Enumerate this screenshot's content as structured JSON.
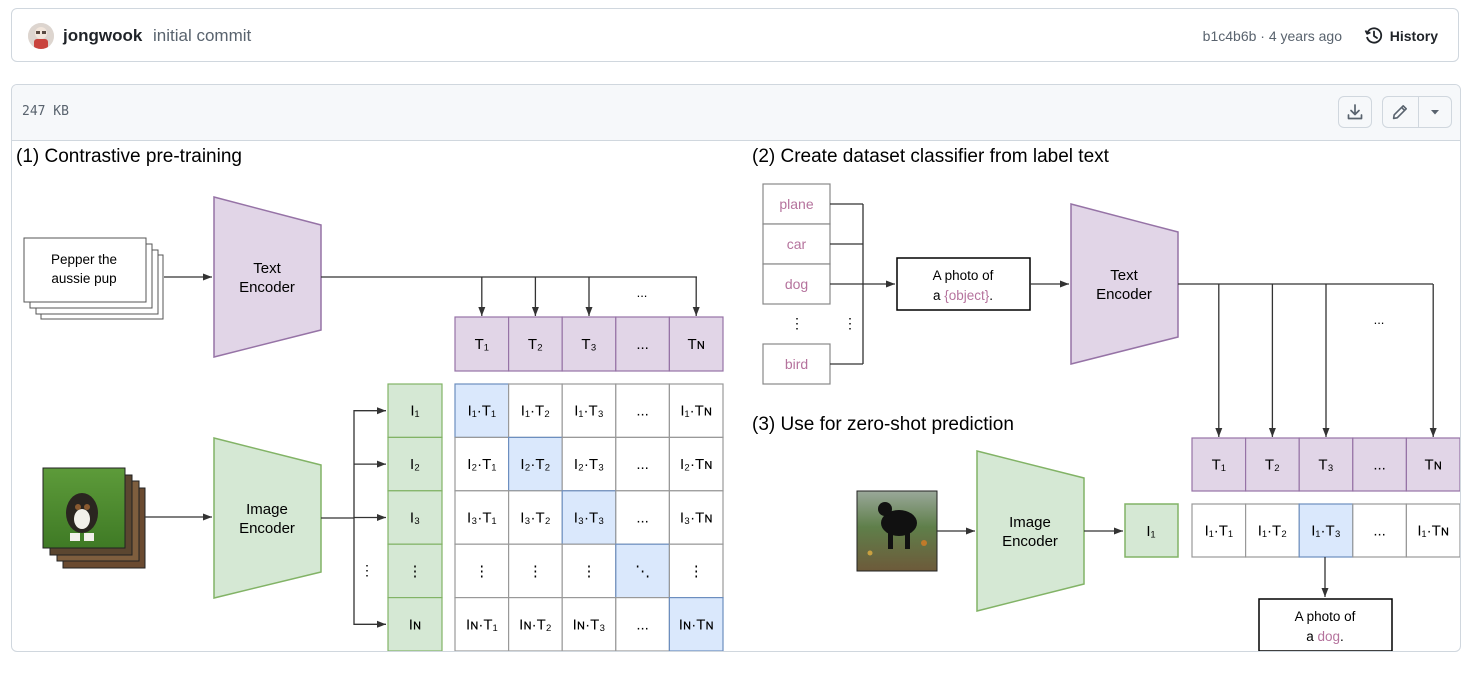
{
  "commit": {
    "author": "jongwook",
    "message": "initial commit",
    "sha_age": "b1c4b6b · 4 years ago",
    "history_label": "History",
    "avatar_icon": "user-avatar",
    "history_icon": "clock-history-icon"
  },
  "file": {
    "size": "247 KB",
    "download_icon": "download-icon",
    "edit_icon": "pencil-icon",
    "dropdown_icon": "triangle-down-icon"
  },
  "figure": {
    "panel1_title": "(1) Contrastive pre-training",
    "panel2_title": "(2) Create dataset classifier from label text",
    "panel3_title": "(3) Use for zero-shot prediction",
    "text_input": [
      "Pepper the",
      "aussie pup"
    ],
    "text_encoder": [
      "Text",
      "Encoder"
    ],
    "image_encoder": [
      "Image",
      "Encoder"
    ],
    "labels": [
      "plane",
      "car",
      "dog",
      "bird"
    ],
    "vdots": "⋮",
    "ellipsis": "...",
    "ddots": "⋱",
    "template": {
      "prefix": "A photo of",
      "line2_prefix": "a ",
      "placeholder": "{object}",
      "suffix": "."
    },
    "prediction": {
      "prefix": "A photo of",
      "line2_prefix": "a ",
      "word": "dog",
      "suffix": "."
    },
    "t_labels": [
      "T₁",
      "T₂",
      "T₃",
      "...",
      "Tɴ"
    ],
    "i_labels": [
      "I₁",
      "I₂",
      "I₃",
      "⋮",
      "Iɴ"
    ],
    "i_single": "I₁",
    "matrix": [
      [
        "I₁·T₁",
        "I₁·T₂",
        "I₁·T₃",
        "...",
        "I₁·Tɴ"
      ],
      [
        "I₂·T₁",
        "I₂·T₂",
        "I₂·T₃",
        "...",
        "I₂·Tɴ"
      ],
      [
        "I₃·T₁",
        "I₃·T₂",
        "I₃·T₃",
        "...",
        "I₃·Tɴ"
      ],
      [
        "⋮",
        "⋮",
        "⋮",
        "⋱",
        "⋮"
      ],
      [
        "Iɴ·T₁",
        "Iɴ·T₂",
        "Iɴ·T₃",
        "...",
        "Iɴ·Tɴ"
      ]
    ],
    "zero_shot_row": [
      "I₁·T₁",
      "I₁·T₂",
      "I₁·T₃",
      "...",
      "I₁·Tɴ"
    ],
    "colors": {
      "text_fill": "#e1d5e7",
      "text_stroke": "#9673a6",
      "image_fill": "#d5e8d4",
      "image_stroke": "#82b366",
      "match_fill": "#dae8fc",
      "match_stroke": "#6c8ebf",
      "label_text": "#b5739d"
    }
  }
}
